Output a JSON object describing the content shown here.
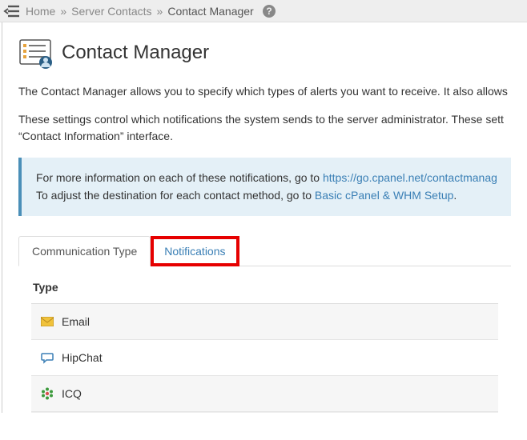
{
  "breadcrumbs": {
    "home": "Home",
    "server_contacts": "Server Contacts",
    "current": "Contact Manager"
  },
  "page": {
    "title": "Contact Manager",
    "intro1": "The Contact Manager allows you to specify which types of alerts you want to receive. It also allows",
    "intro2_a": "These settings control which notifications the system sends to the server administrator. These sett",
    "intro2_b": "“Contact Information” interface."
  },
  "infobox": {
    "line1_pre": "For more information on each of these notifications, go to ",
    "line1_link": "https://go.cpanel.net/contactmanag",
    "line2_pre": "To adjust the destination for each contact method, go to ",
    "line2_link": "Basic cPanel & WHM Setup",
    "line2_post": "."
  },
  "tabs": {
    "communication": "Communication Type",
    "notifications": "Notifications"
  },
  "table": {
    "header_type": "Type",
    "rows": [
      {
        "label": "Email"
      },
      {
        "label": "HipChat"
      },
      {
        "label": "ICQ"
      }
    ]
  }
}
